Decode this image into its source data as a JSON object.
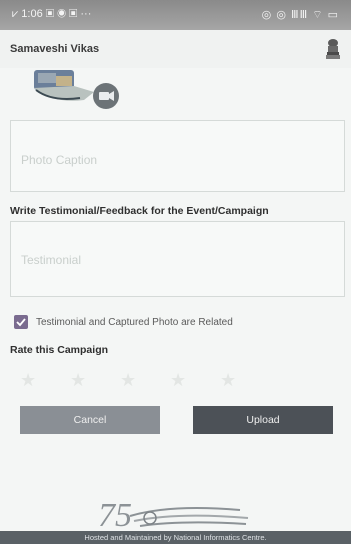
{
  "status_bar": {
    "time": "1:06",
    "left_icons": "▣ ◉ ▣ ···",
    "right_icons": "◎ ◎ ⅢⅢ ⌔ ▭"
  },
  "header": {
    "title": "Samaveshi Vikas",
    "emblem_icon": "national-emblem-icon"
  },
  "photo": {
    "video_icon": "video-camera-icon"
  },
  "caption": {
    "placeholder": "Photo Caption"
  },
  "testimonial": {
    "section_label": "Write Testimonial/Feedback for the Event/Campaign",
    "placeholder": "Testimonial"
  },
  "relation_check": {
    "checked": true,
    "label": "Testimonial and Captured Photo are Related"
  },
  "rating": {
    "section_label": "Rate this Campaign",
    "max_stars": 5,
    "value": 0
  },
  "buttons": {
    "cancel_label": "Cancel",
    "upload_label": "Upload"
  },
  "footer": {
    "text": "Hosted and Maintained by National Informatics Centre."
  },
  "colors": {
    "cancel_bg": "#8a8f95",
    "upload_bg": "#4c5157",
    "checkbox": "#7a6b8f",
    "footer_bg": "#5a6166"
  }
}
